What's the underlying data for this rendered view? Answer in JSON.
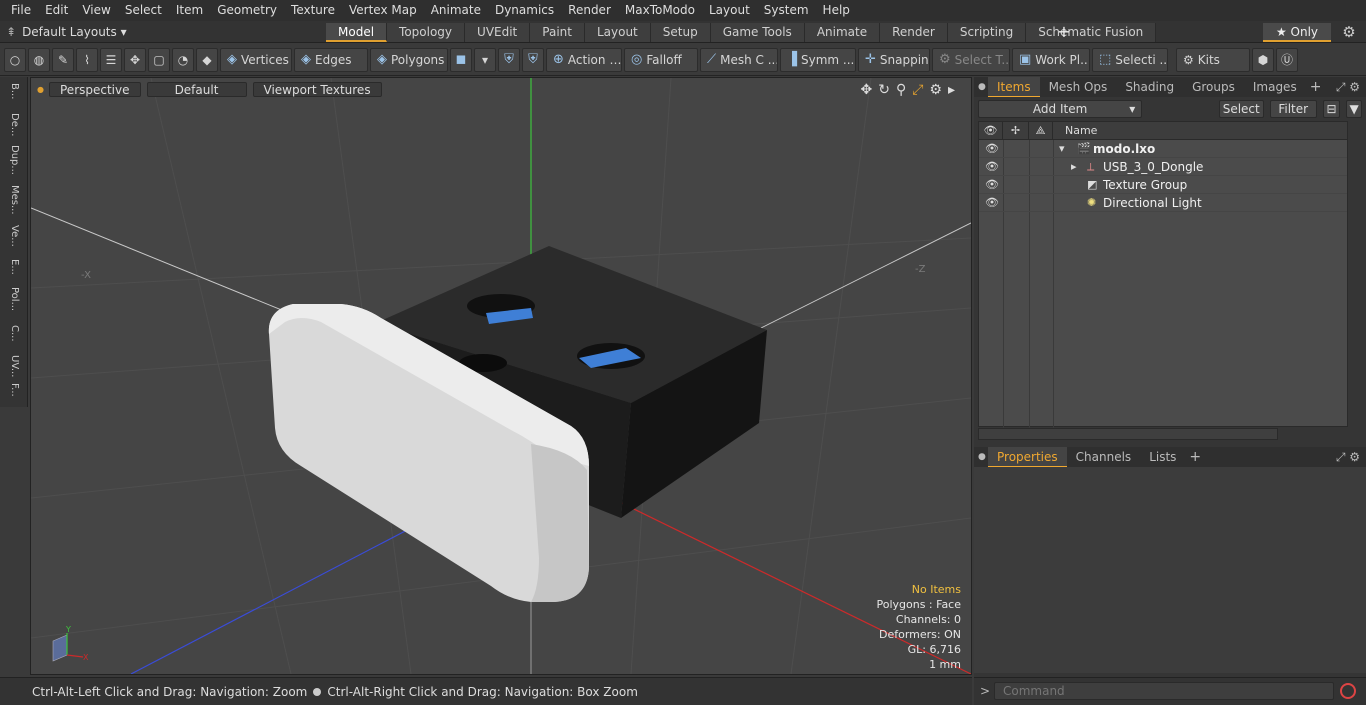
{
  "menu": [
    "File",
    "Edit",
    "View",
    "Select",
    "Item",
    "Geometry",
    "Texture",
    "Vertex Map",
    "Animate",
    "Dynamics",
    "Render",
    "MaxToModo",
    "Layout",
    "System",
    "Help"
  ],
  "layout_selector": "Default Layouts ▾",
  "layout_tabs": [
    {
      "label": "Model",
      "active": true
    },
    {
      "label": "Topology"
    },
    {
      "label": "UVEdit"
    },
    {
      "label": "Paint"
    },
    {
      "label": "Layout"
    },
    {
      "label": "Setup"
    },
    {
      "label": "Game Tools"
    },
    {
      "label": "Animate"
    },
    {
      "label": "Render"
    },
    {
      "label": "Scripting"
    },
    {
      "label": "Schematic Fusion"
    }
  ],
  "only_label": "★ Only",
  "toolbar": {
    "vertices": "Vertices",
    "edges": "Edges",
    "polygons": "Polygons",
    "action": "Action",
    "falloff": "Falloff",
    "mesh": "Mesh C ...",
    "symm": "Symm ...",
    "snapping": "Snapping",
    "select_t": "Select T...",
    "work_pl": "Work Pl...",
    "selecti": "Selecti ...",
    "kits": "Kits"
  },
  "left_tabs": [
    "B...",
    "De...",
    "Dup...",
    "Mes...",
    "Ve...",
    "E...",
    "Pol...",
    "C...",
    "UV...",
    "F..."
  ],
  "viewport": {
    "perspective": "Perspective",
    "default": "Default",
    "textures": "Viewport Textures"
  },
  "stats": {
    "no_items": "No Items",
    "polygons": "Polygons : Face",
    "channels": "Channels: 0",
    "deformers": "Deformers: ON",
    "gl": "GL: 6,716",
    "unit": "1 mm"
  },
  "status": {
    "left": "Ctrl-Alt-Left Click and Drag: Navigation: Zoom",
    "right": "Ctrl-Alt-Right Click and Drag: Navigation: Box Zoom"
  },
  "panel_tabs": [
    "Items",
    "Mesh Ops",
    "Shading",
    "Groups",
    "Images"
  ],
  "items_bar": {
    "add_item": "Add Item",
    "select": "Select",
    "filter": "Filter"
  },
  "tree_header": {
    "name": "Name"
  },
  "tree": [
    {
      "label": "modo.lxo",
      "bold": true
    },
    {
      "label": "USB_3_0_Dongle"
    },
    {
      "label": "Texture Group"
    },
    {
      "label": "Directional Light"
    }
  ],
  "props_tabs": [
    "Properties",
    "Channels",
    "Lists"
  ],
  "command_placeholder": "Command",
  "colors": {
    "accent": "#f0a830",
    "x_axis": "#cc2a2a",
    "y_axis": "#3ec43e",
    "z_axis": "#3a4cd8"
  }
}
